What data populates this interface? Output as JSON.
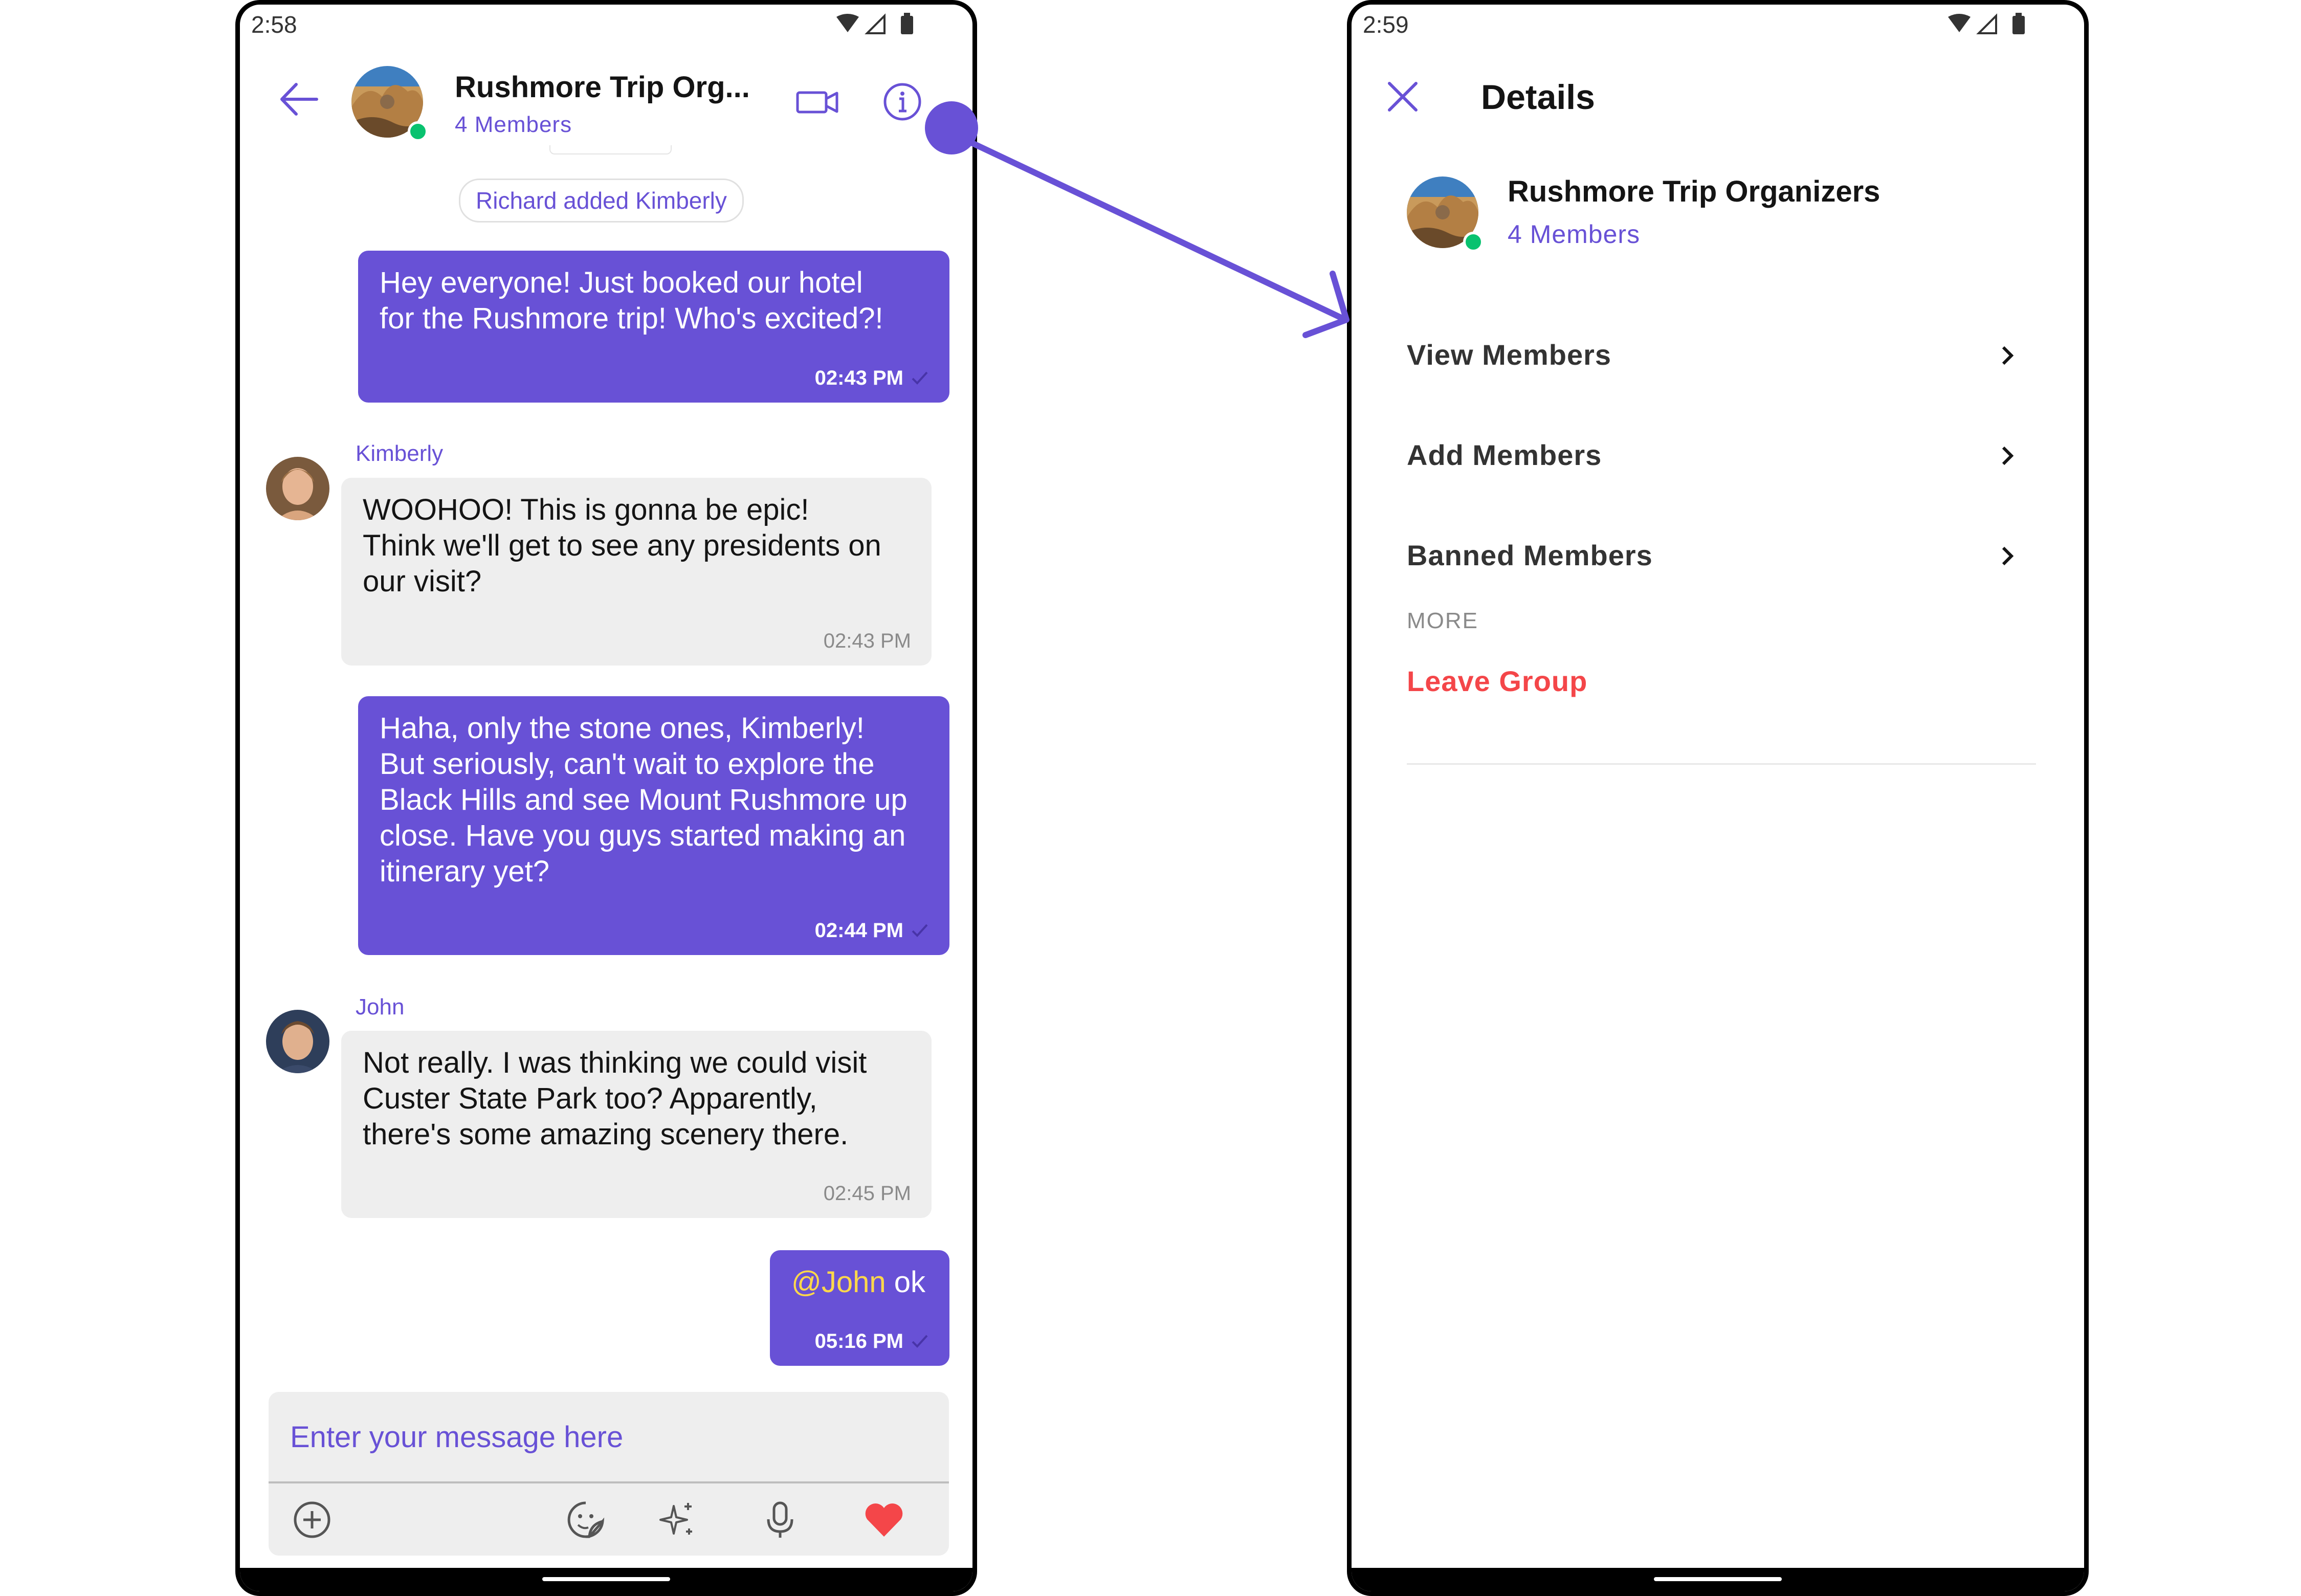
{
  "left_screen": {
    "status_time": "2:58",
    "header": {
      "title": "Rushmore Trip Org...",
      "subtitle": "4 Members"
    },
    "action_message": "Richard added Kimberly",
    "messages": [
      {
        "direction": "outgoing",
        "text": "Hey everyone!   Just booked our hotel\nfor the Rushmore trip!  Who's excited?!",
        "time": "02:43 PM"
      },
      {
        "direction": "incoming",
        "sender": "Kimberly",
        "text": "WOOHOO!  This is gonna be epic!\nThink we'll get to see any presidents on\nour visit?",
        "time": "02:43 PM"
      },
      {
        "direction": "outgoing",
        "text": " Haha, only the stone ones, Kimberly!\nBut seriously, can't wait to explore the\nBlack Hills and see Mount Rushmore up\nclose.  Have you guys started making an\nitinerary yet?",
        "time": "02:44 PM"
      },
      {
        "direction": "incoming",
        "sender": "John",
        "text": "Not really.  I was thinking we could visit\nCuster State Park too?  Apparently,\nthere's some amazing scenery there.",
        "time": "02:45 PM"
      },
      {
        "direction": "outgoing",
        "mention": "@John",
        "text": " ok",
        "time": "05:16 PM"
      }
    ],
    "composer": {
      "placeholder": "Enter your message here",
      "icons": [
        "add-icon",
        "sticker-icon",
        "ai-sparkle-icon",
        "microphone-icon",
        "heart-icon"
      ]
    }
  },
  "right_screen": {
    "status_time": "2:59",
    "title": "Details",
    "group_name": "Rushmore Trip Organizers",
    "group_subtitle": "4 Members",
    "options": [
      {
        "label": "View Members"
      },
      {
        "label": "Add Members"
      },
      {
        "label": "Banned Members"
      }
    ],
    "section_header": "MORE",
    "leave_label": "Leave Group"
  },
  "colors": {
    "primary": "#6851d6",
    "incoming_bubble": "#eeeeee",
    "danger": "#f44649",
    "online": "#09c26f",
    "mention": "#ffd84a",
    "heart": "#f44649"
  }
}
